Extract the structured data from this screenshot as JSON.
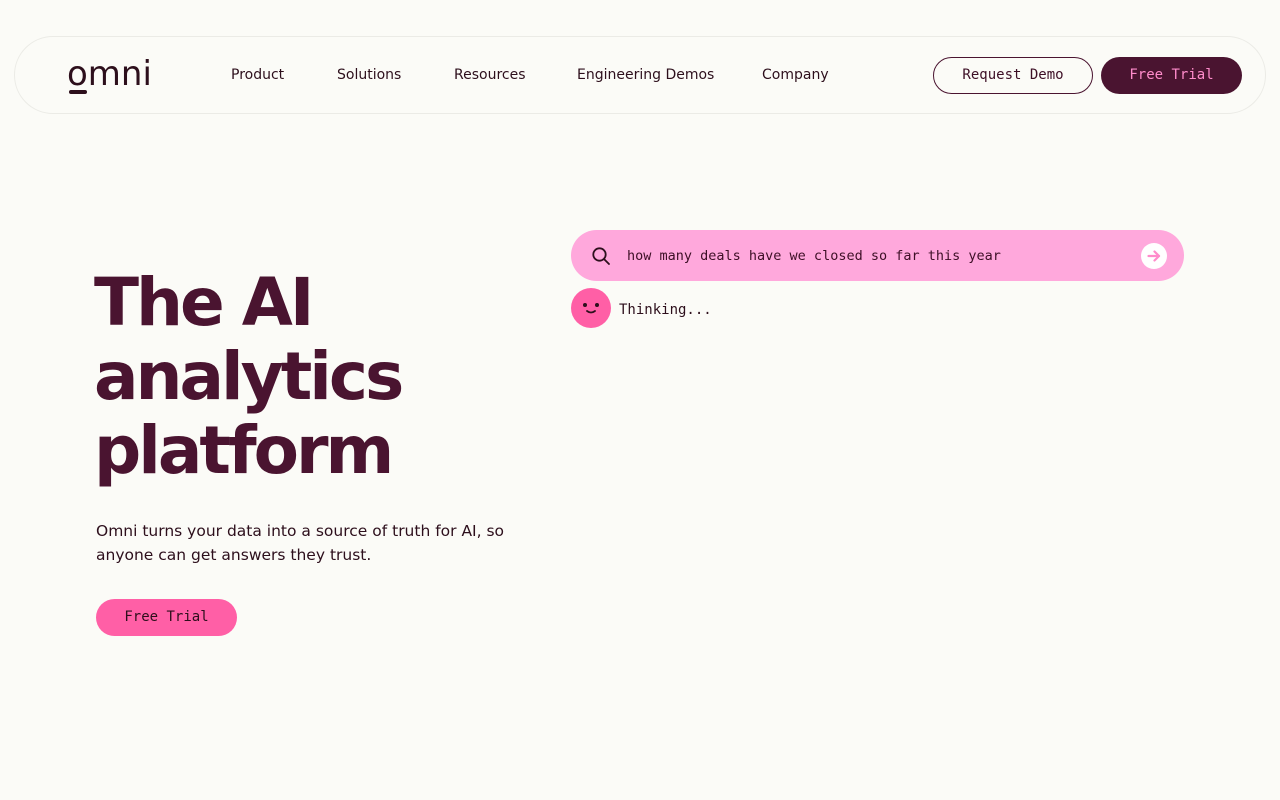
{
  "header": {
    "logo_text": "omni",
    "nav": [
      {
        "label": "Product"
      },
      {
        "label": "Solutions"
      },
      {
        "label": "Resources"
      },
      {
        "label": "Engineering Demos"
      },
      {
        "label": "Company"
      }
    ],
    "request_demo_label": "Request Demo",
    "free_trial_label": "Free Trial"
  },
  "hero": {
    "title_lines": [
      "The AI",
      "analytics",
      "platform"
    ],
    "subtitle_lines": [
      "Omni turns your data into a source of truth for AI, so",
      "anyone can get answers they trust."
    ],
    "cta_label": "Free Trial"
  },
  "demo": {
    "query": "how many deals have we closed so far this year",
    "status": "Thinking..."
  },
  "colors": {
    "background": "#fbfbf7",
    "brand_dark": "#4a1430",
    "brand_pink": "#ff5fa6",
    "search_pink": "#ffa8dc",
    "pink_text": "#ff8ccb"
  },
  "icons": {
    "search": "search-icon",
    "submit": "arrow-right-icon",
    "assistant": "smiley-face-icon"
  }
}
